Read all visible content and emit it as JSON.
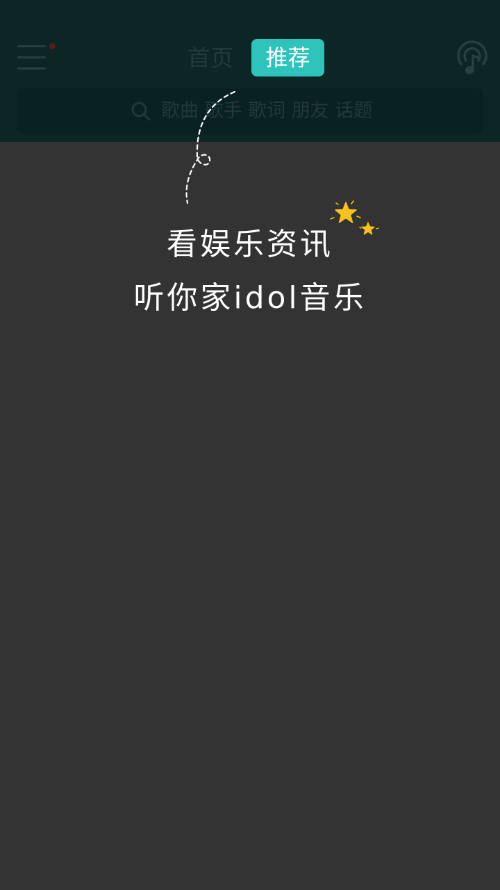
{
  "header": {
    "tabs": [
      {
        "label": "首页",
        "active": false
      },
      {
        "label": "推荐",
        "active": true
      }
    ],
    "menu_icon": "hamburger-menu-icon",
    "menu_badge": "notification-dot",
    "right_icon": "listen-identify-icon",
    "accent_color": "#2ec4bc"
  },
  "search": {
    "icon": "search-icon",
    "placeholder": "歌曲 歌手 歌词 朋友 话题"
  },
  "guide": {
    "line1": "看娱乐资讯",
    "line2": "听你家idol音乐",
    "decoration": "star-icons"
  }
}
